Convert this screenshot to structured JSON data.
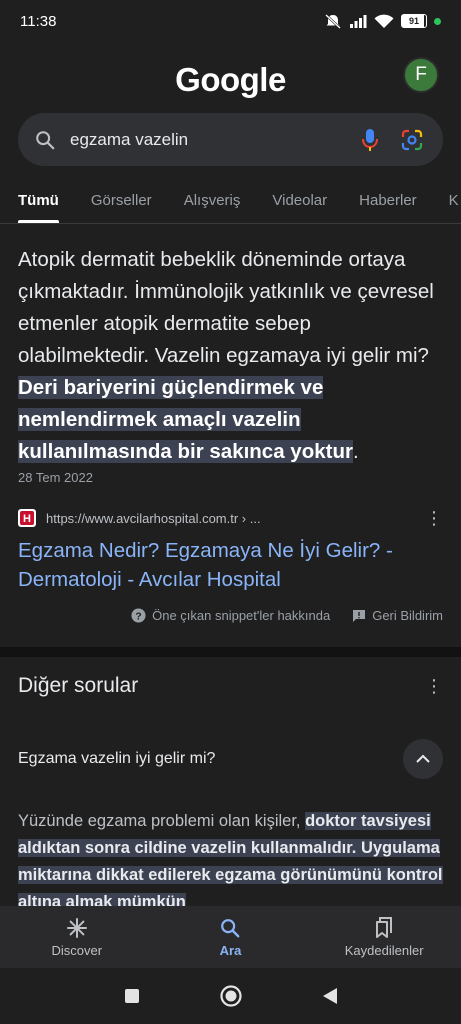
{
  "status": {
    "time": "11:38",
    "battery": "91",
    "battery_level": 0.91
  },
  "header": {
    "logo": "Google",
    "avatar_letter": "F"
  },
  "search": {
    "query": "egzama vazelin"
  },
  "tabs": [
    "Tümü",
    "Görseller",
    "Alışveriş",
    "Videolar",
    "Haberler",
    "K"
  ],
  "featured": {
    "text_before": "Atopik dermatit bebeklik döneminde ortaya çıkmaktadır. İmmünolojik yatkınlık ve çevresel etmenler atopik dermatite sebep olabilmektedir. Vazelin egzamaya iyi gelir mi? ",
    "text_highlight": "Deri bariyerini güçlendirmek ve nemlendirmek amaçlı vazelin kullanılmasında bir sakınca yoktur",
    "text_after": ".",
    "date": "28 Tem 2022",
    "source_url": "https://www.avcilarhospital.com.tr › ...",
    "title": "Egzama Nedir? Egzamaya Ne İyi Gelir? - Dermatoloji - Avcılar Hospital",
    "about_label": "Öne çıkan snippet'ler hakkında",
    "feedback_label": "Geri Bildirim"
  },
  "other_questions": {
    "heading": "Diğer sorular",
    "question": "Egzama vazelin iyi gelir mi?",
    "answer_before": "Yüzünde egzama problemi olan kişiler, ",
    "answer_highlight": "doktor tavsiyesi aldıktan sonra cildine vazelin kullanmalıdır. Uygulama miktarına dikkat edilerek egzama görünümünü kontrol altına almak mümkün"
  },
  "bottom_nav": {
    "discover": "Discover",
    "search": "Ara",
    "saved": "Kaydedilenler"
  }
}
